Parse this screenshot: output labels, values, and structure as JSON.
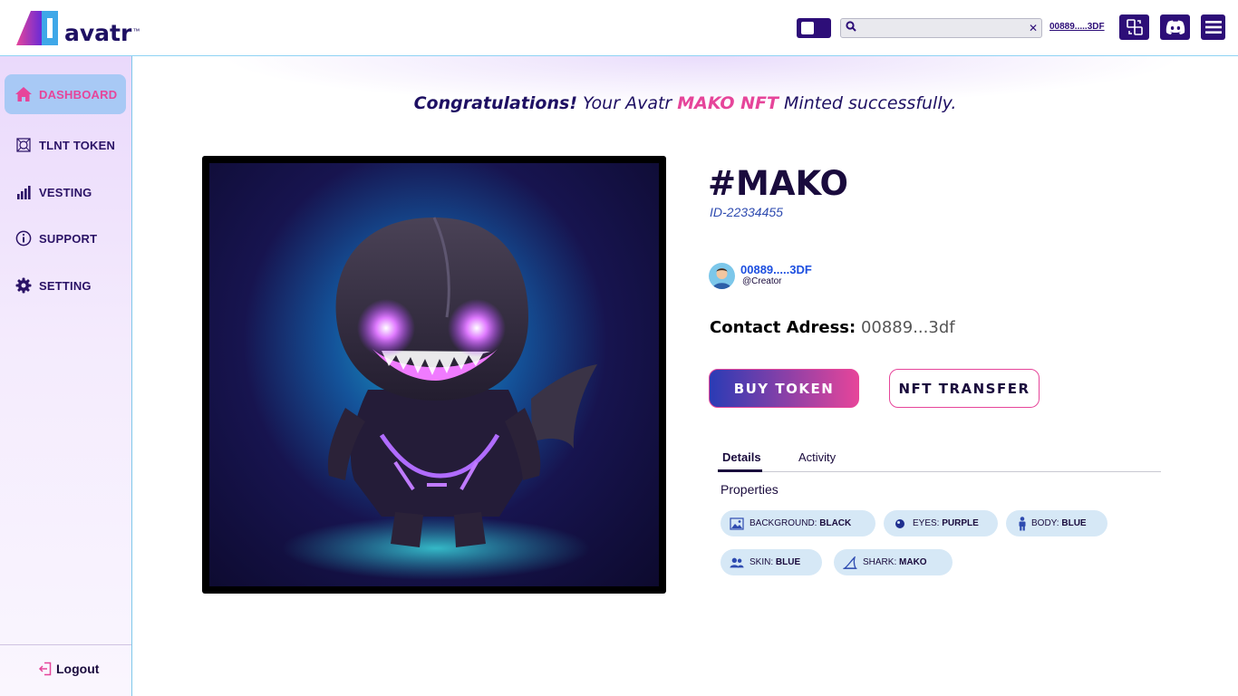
{
  "brand": {
    "name": "avatr",
    "tm": "™"
  },
  "header": {
    "search_placeholder": "",
    "search_clear": "✕",
    "wallet_short": "00889.....3DF"
  },
  "sidebar": {
    "items": [
      {
        "label": "DASHBOARD",
        "icon": "home-icon",
        "active": true
      },
      {
        "label": "TLNT TOKEN",
        "icon": "token-icon"
      },
      {
        "label": "VESTING",
        "icon": "bar-chart-icon"
      },
      {
        "label": "SUPPORT",
        "icon": "info-icon"
      },
      {
        "label": "SETTING",
        "icon": "gear-icon"
      }
    ],
    "logout": "Logout"
  },
  "banner": {
    "lead": "Congratulations!",
    "part1": " Your Avatr ",
    "highlight": "MAKO NFT",
    "part2": " Minted successfully."
  },
  "nft": {
    "title": "#MAKO",
    "id": "ID-22334455",
    "creator_name": "00889.....3DF",
    "creator_role": "@Creator",
    "contact_label": "Contact Adress:",
    "contact_value": " 00889...3df"
  },
  "actions": {
    "buy": "BUY TOKEN",
    "transfer": "NFT TRANSFER"
  },
  "tabs": {
    "details": "Details",
    "activity": "Activity"
  },
  "properties": {
    "label": "Properties",
    "items": [
      {
        "key": "BACKGROUND:",
        "value": "BLACK",
        "icon": "image-icon"
      },
      {
        "key": "EYES:",
        "value": "PURPLE",
        "icon": "eye-icon"
      },
      {
        "key": "BODY:",
        "value": "BLUE",
        "icon": "body-icon"
      },
      {
        "key": "SKIN:",
        "value": "BLUE",
        "icon": "users-icon"
      },
      {
        "key": "SHARK:",
        "value": "MAKO",
        "icon": "fin-icon"
      }
    ]
  },
  "colors": {
    "brand_dark": "#2d0e78",
    "accent_pink": "#e6459a",
    "link_blue": "#1d4fe0"
  }
}
